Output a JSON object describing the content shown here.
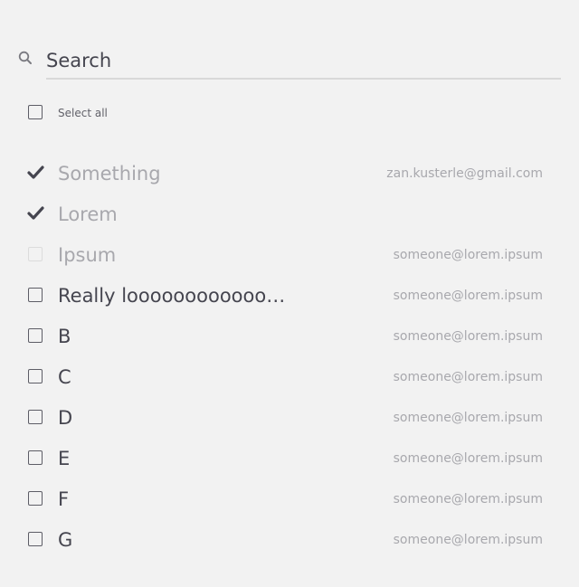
{
  "search": {
    "placeholder": "Search",
    "icon": "search-icon"
  },
  "select_all": {
    "label": "Select all",
    "checked": false
  },
  "items": [
    {
      "label": "Something",
      "email": "zan.kusterle@gmail.com",
      "state": "checked"
    },
    {
      "label": "Lorem",
      "email": "",
      "state": "checked"
    },
    {
      "label": "Ipsum",
      "email": "someone@lorem.ipsum",
      "state": "disabled"
    },
    {
      "label": "Really looooooooooooo…",
      "email": "someone@lorem.ipsum",
      "state": "unchecked"
    },
    {
      "label": "B",
      "email": "someone@lorem.ipsum",
      "state": "unchecked"
    },
    {
      "label": "C",
      "email": "someone@lorem.ipsum",
      "state": "unchecked"
    },
    {
      "label": "D",
      "email": "someone@lorem.ipsum",
      "state": "unchecked"
    },
    {
      "label": "E",
      "email": "someone@lorem.ipsum",
      "state": "unchecked"
    },
    {
      "label": "F",
      "email": "someone@lorem.ipsum",
      "state": "unchecked"
    },
    {
      "label": "G",
      "email": "someone@lorem.ipsum",
      "state": "unchecked"
    }
  ],
  "colors": {
    "background": "#f2f2f2",
    "text": "#45454f",
    "muted_text": "#a8a8ad",
    "checkbox_border": "#5d5d66",
    "divider": "#d9d9d9"
  }
}
